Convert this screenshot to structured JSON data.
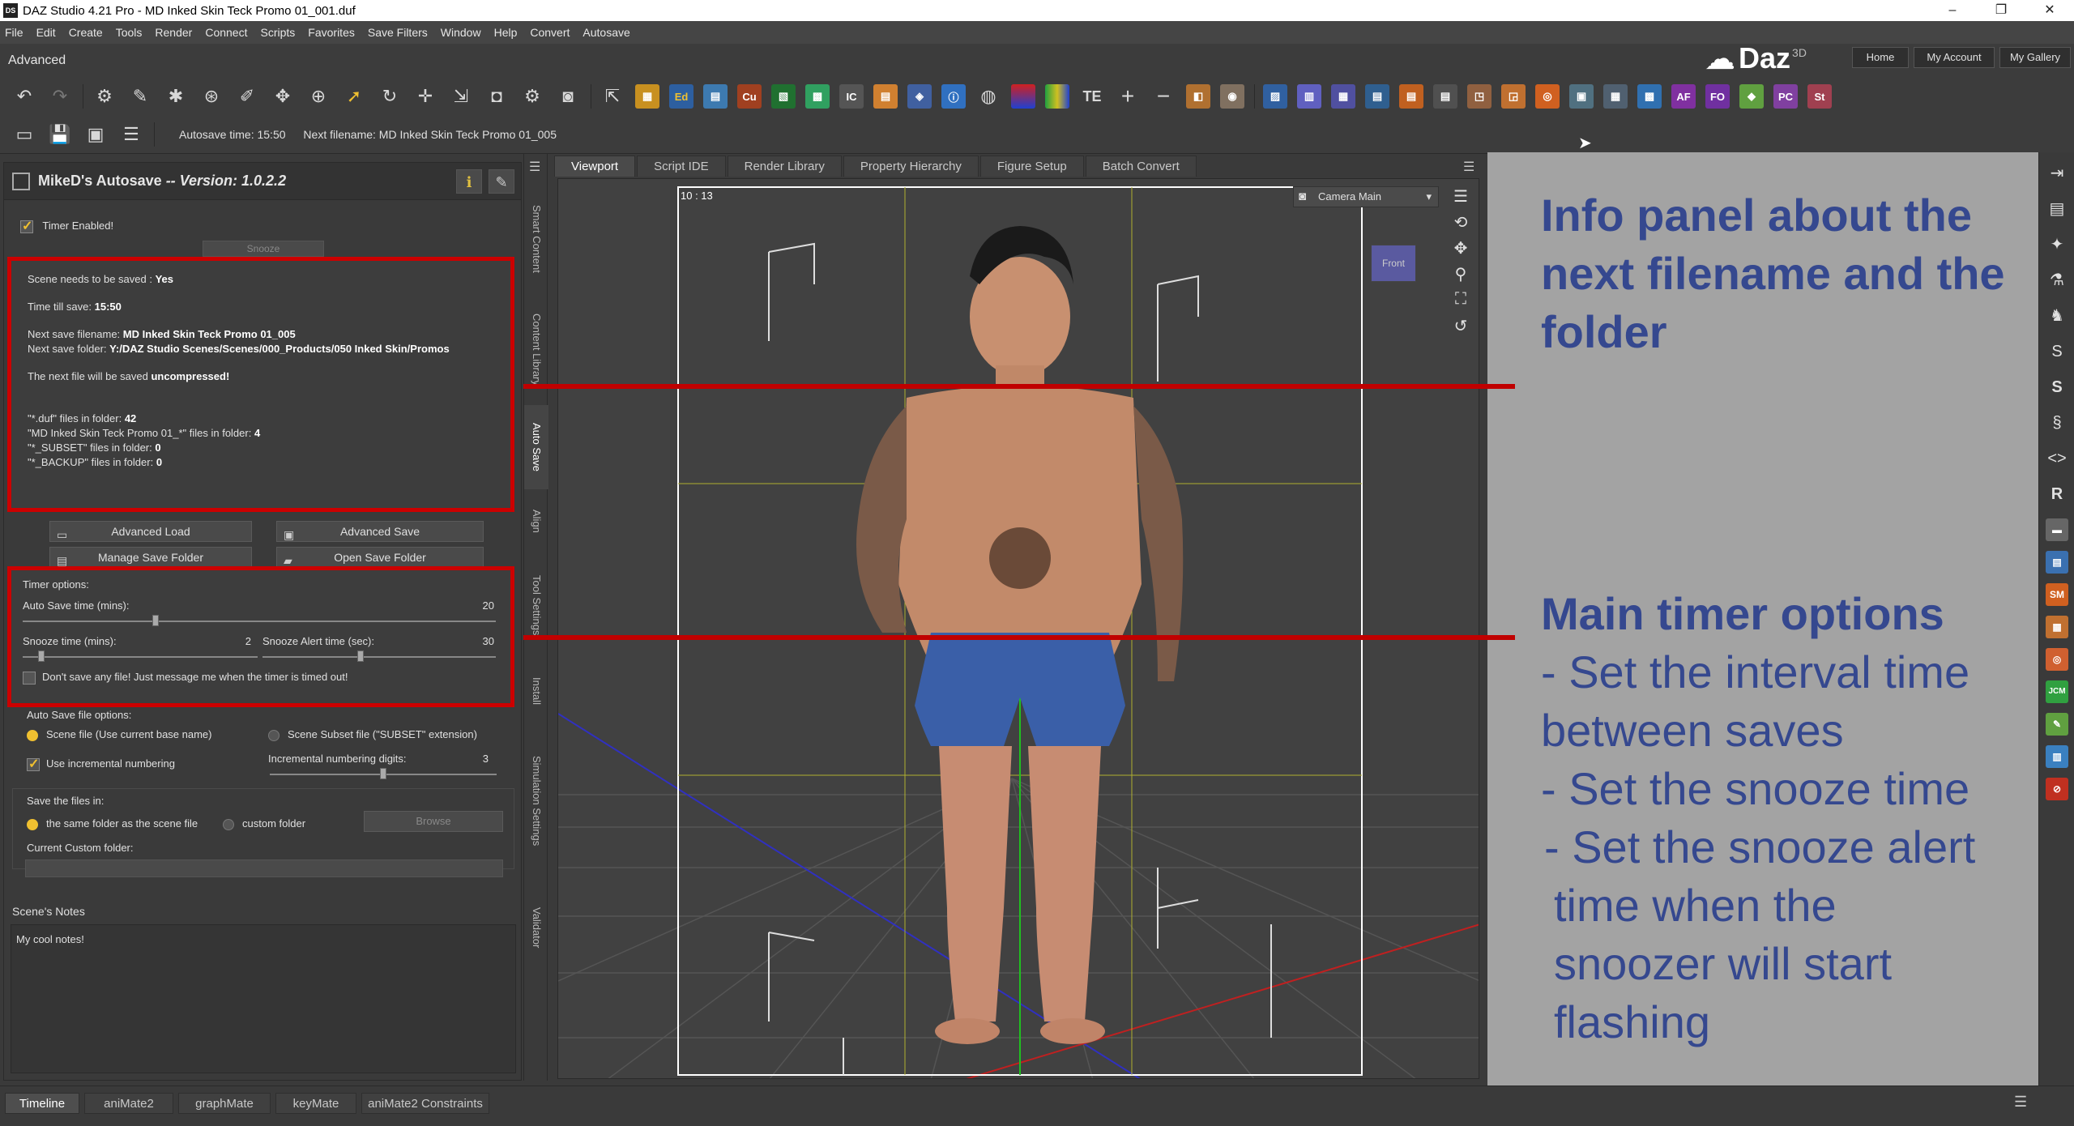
{
  "window": {
    "title": "DAZ Studio 4.21 Pro - MD Inked Skin Teck Promo 01_001.duf",
    "app_icon_label": "DS"
  },
  "menu": [
    "File",
    "Edit",
    "Create",
    "Tools",
    "Render",
    "Connect",
    "Scripts",
    "Favorites",
    "Save Filters",
    "Window",
    "Help",
    "Convert",
    "Autosave"
  ],
  "layout_label": "Advanced",
  "brand": {
    "name": "Daz",
    "superscript": "3D"
  },
  "top_nav": [
    "Home",
    "My Account",
    "My Gallery"
  ],
  "toolbar1_icons": [
    "undo-icon",
    "redo-icon",
    "joint-editor-icon",
    "node-weight-icon",
    "geometry-editor-icon",
    "universal-icon",
    "surface-selection-icon",
    "active-pose-icon",
    "region-navigator-icon",
    "node-selection-icon",
    "rotate-icon",
    "translate-icon",
    "scale-icon",
    "spot-render-icon",
    "render-settings-icon",
    "camera-icon"
  ],
  "toolbar1_labels": {
    "te": "TE"
  },
  "autosave": {
    "time_label": "Autosave time: 15:50",
    "filename_label": "Next filename: MD Inked Skin Teck Promo 01_005"
  },
  "panel": {
    "title": "MikeD's Autosave",
    "version": "-- Version: 1.0.2.2",
    "timer_enabled": "Timer Enabled!",
    "snooze": "Snooze",
    "info": {
      "scene_needs_save_label": "Scene needs to be saved :",
      "scene_needs_save_value": "Yes",
      "time_till_save_label": "Time till save:",
      "time_till_save_value": "15:50",
      "next_filename_label": "Next save filename:",
      "next_filename_value": "MD Inked Skin Teck Promo 01_005",
      "next_folder_label": "Next save folder:",
      "next_folder_value": "Y:/DAZ Studio Scenes/Scenes/000_Products/050 Inked Skin/Promos",
      "compression_prefix": "The next file will be saved",
      "compression_value": "uncompressed",
      "duf_count_label": "\"*.duf\" files in folder:",
      "duf_count_value": "42",
      "promo_count_label": "\"MD Inked Skin Teck Promo 01_*\" files in folder:",
      "promo_count_value": "4",
      "subset_count_label": "\"*_SUBSET\" files in folder:",
      "subset_count_value": "0",
      "backup_count_label": "\"*_BACKUP\" files in folder:",
      "backup_count_value": "0"
    },
    "buttons": {
      "advanced_load": "Advanced Load",
      "advanced_save": "Advanced Save",
      "manage_folder": "Manage Save Folder",
      "open_folder": "Open Save Folder"
    },
    "timer": {
      "header": "Timer options:",
      "autosave_label": "Auto Save time (mins):",
      "autosave_value": "20",
      "autosave_fraction": 0.28,
      "snooze_label": "Snooze time (mins):",
      "snooze_value": "2",
      "snooze_fraction": 0.08,
      "alert_label": "Snooze Alert time (sec):",
      "alert_value": "30",
      "alert_fraction": 0.42,
      "dont_save": "Don't save any file! Just message me when the timer is timed out!"
    },
    "file_options": {
      "header": "Auto Save file options:",
      "scene_file": "Scene file (Use current base name)",
      "subset_file": "Scene Subset file (\"SUBSET\" extension)",
      "incremental": "Use incremental numbering",
      "digits_label": "Incremental numbering digits:",
      "digits_value": "3",
      "digits_fraction": 0.5
    },
    "save_in": {
      "header": "Save the files in:",
      "same_folder": "the same folder as the scene file",
      "custom_folder": "custom folder",
      "browse": "Browse",
      "current_custom": "Current Custom folder:"
    },
    "notes_label": "Scene's Notes",
    "notes": "My cool notes!"
  },
  "vertical_tabs": [
    "Smart Content",
    "Content Library",
    "Auto Save",
    "Align",
    "Tool Settings",
    "Install",
    "Simulation Settings",
    "Validator"
  ],
  "viewport_tabs": [
    "Viewport",
    "Script IDE",
    "Render Library",
    "Property Hierarchy",
    "Figure Setup",
    "Batch Convert"
  ],
  "viewport": {
    "fps": "10 : 13",
    "camera": "Camera Main",
    "cube_face": "Front"
  },
  "annotations": {
    "info_title": [
      "Info panel about the",
      "next filename and the",
      "folder"
    ],
    "main_title": "Main timer options",
    "bullets": [
      "- Set the interval time",
      "between saves",
      "- Set the snooze time",
      "- Set the snooze alert",
      " time when the",
      " snoozer will start",
      " flashing"
    ]
  },
  "right_sidebar_labels": [
    "S",
    "S",
    "R",
    "SM",
    "JCM"
  ],
  "bottom_tabs": [
    "Timeline",
    "aniMate2",
    "graphMate",
    "keyMate",
    "aniMate2 Constraints"
  ],
  "colors": {
    "highlight_red": "#c00000",
    "annotation_text": "#35488f",
    "annotation_bg": "#a3a3a3",
    "checkbox_accent": "#f0c030"
  }
}
